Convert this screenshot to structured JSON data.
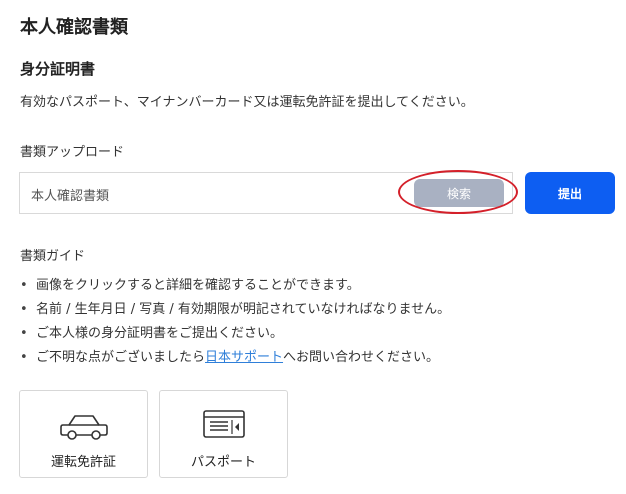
{
  "page": {
    "title": "本人確認書類"
  },
  "section": {
    "title": "身分証明書",
    "description": "有効なパスポート、マイナンバーカード又は運転免許証を提出してください。"
  },
  "upload": {
    "label": "書類アップロード",
    "placeholder": "本人確認書類",
    "search_label": "検索",
    "submit_label": "提出"
  },
  "guide": {
    "title": "書類ガイド",
    "items": [
      "画像をクリックすると詳細を確認することができます。",
      "名前 / 生年月日 / 写真 / 有効期限が明記されていなければなりません。",
      "ご本人様の身分証明書をご提出ください。"
    ],
    "last_prefix": "ご不明な点がございましたら",
    "last_link": "日本サポート",
    "last_suffix": "へお問い合わせください。"
  },
  "documents": [
    {
      "label": "運転免許証",
      "icon": "car-icon"
    },
    {
      "label": "パスポート",
      "icon": "id-card-icon"
    }
  ],
  "colors": {
    "primary": "#0d5ef2",
    "search_button": "#a9b1c2",
    "highlight": "#d4202a",
    "link": "#2f7fd9"
  }
}
